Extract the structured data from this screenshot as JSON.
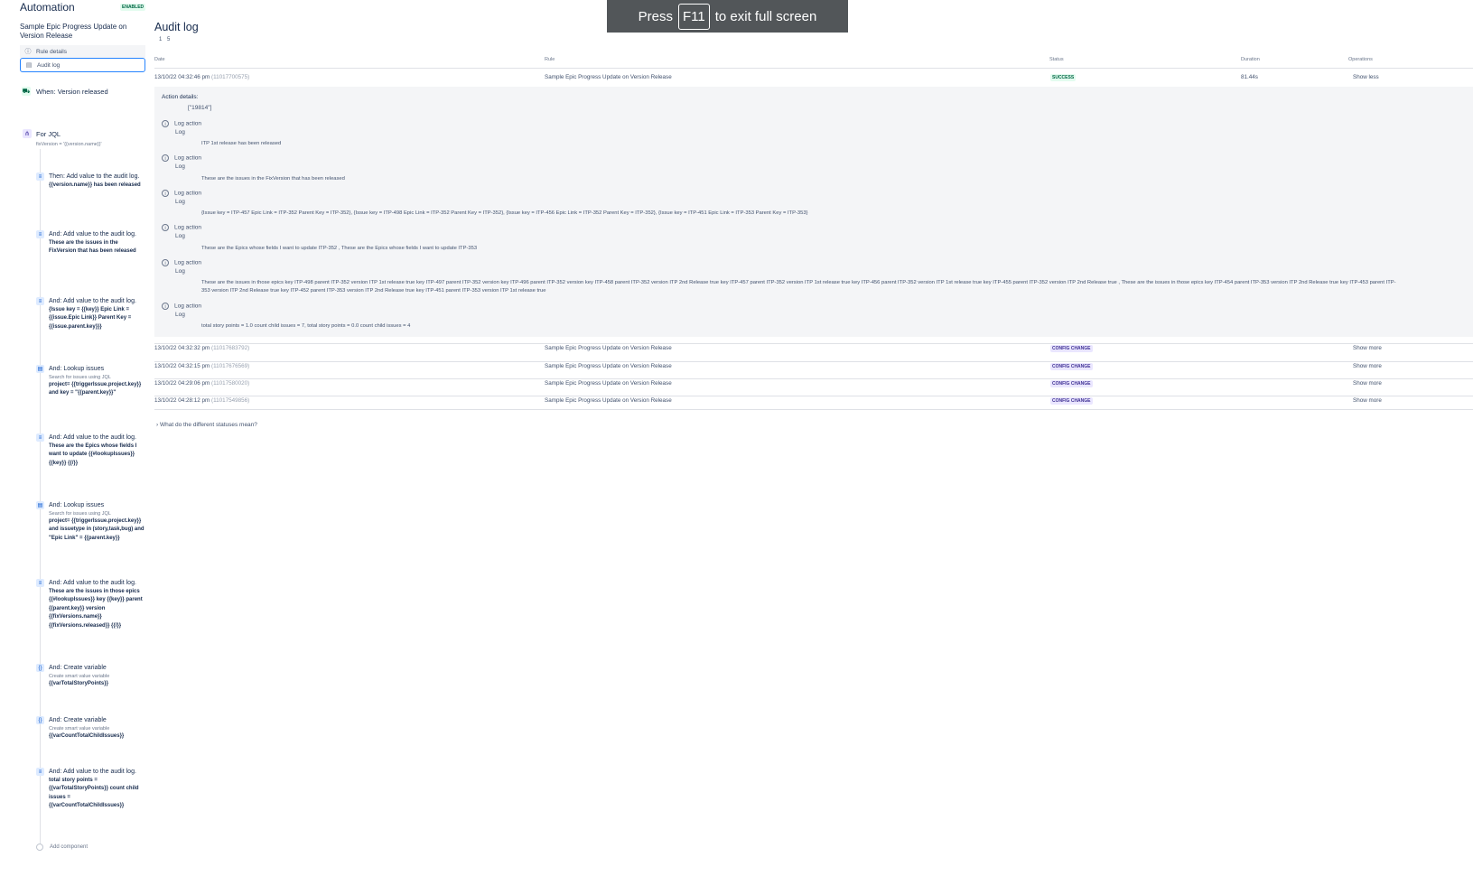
{
  "app": {
    "title": "Automation",
    "status_badge": "ENABLED"
  },
  "rule": {
    "name": "Sample Epic Progress Update on Version Release"
  },
  "nav": {
    "rule_details": "Rule details",
    "audit_log": "Audit log"
  },
  "trigger": {
    "label": "When: Version released"
  },
  "branch": {
    "label": "For JQL",
    "query": "fixVersion = '{{version.name}}'"
  },
  "components": [
    {
      "icon": "document-icon",
      "glyph": "≡",
      "title": "Then: Add value to the audit log.",
      "desc": "",
      "body": "{{version.name}} has been released"
    },
    {
      "icon": "document-icon",
      "glyph": "≡",
      "title": "And: Add value to the audit log.",
      "desc": "",
      "body": "These are the issues in the FixVersion that has been released"
    },
    {
      "icon": "document-icon",
      "glyph": "≡",
      "title": "And: Add value to the audit log.",
      "desc": "",
      "body": "{Issue key = {{key}} Epic Link = {{issue.Epic Link}} Parent Key = {{issue.parent.key}}}"
    },
    {
      "icon": "lookup-icon",
      "glyph": "▤",
      "title": "And: Lookup issues",
      "desc": "Search for issues using JQL",
      "body": "project= {{triggerIssue.project.key}} and key = \"{{parent.key}}\""
    },
    {
      "icon": "document-icon",
      "glyph": "≡",
      "title": "And: Add value to the audit log.",
      "desc": "",
      "body": "These are the Epics whose fields I want to update {{#lookupIssues}} {{key}} {{/}}"
    },
    {
      "icon": "lookup-icon",
      "glyph": "▤",
      "title": "And: Lookup issues",
      "desc": "Search for issues using JQL",
      "body": "project= {{triggerIssue.project.key}} and issuetype in (story,task,bug) and \"Epic Link\" = {{parent.key}}"
    },
    {
      "icon": "document-icon",
      "glyph": "≡",
      "title": "And: Add value to the audit log.",
      "desc": "",
      "body": "These are the issues in those epics {{#lookupIssues}} key {{key}} parent {{parent.key}} version {{fixVersions.name}} {{fixVersions.released}} {{/}}"
    },
    {
      "icon": "variable-icon",
      "glyph": "{}",
      "title": "And: Create variable",
      "desc": "Create smart value variable",
      "body": "{{varTotalStoryPoints}}"
    },
    {
      "icon": "variable-icon",
      "glyph": "{}",
      "title": "And: Create variable",
      "desc": "Create smart value variable",
      "body": "{{varCountTotalChildIssues}}"
    },
    {
      "icon": "document-icon",
      "glyph": "≡",
      "title": "And: Add value to the audit log.",
      "desc": "",
      "body": "total story points = {{varTotalStoryPoints}} count child issues = {{varCountTotalChildIssues}}"
    }
  ],
  "add_component": "Add component",
  "audit": {
    "title": "Audit log",
    "pages": "1 5",
    "columns": {
      "date": "Date",
      "rule": "Rule",
      "status": "Status",
      "duration": "Duration",
      "operations": "Operations"
    },
    "rows": [
      {
        "date": "13/10/22 04:32:46 pm",
        "id": "(11017700575)",
        "rule": "Sample Epic Progress Update on Version Release",
        "status": "SUCCESS",
        "duration": "81.44s",
        "op": "Show less"
      },
      {
        "date": "13/10/22 04:32:32 pm",
        "id": "(11017683792)",
        "rule": "Sample Epic Progress Update on Version Release",
        "status": "CONFIG CHANGE",
        "duration": "",
        "op": "Show more"
      },
      {
        "date": "13/10/22 04:32:15 pm",
        "id": "(11017676569)",
        "rule": "Sample Epic Progress Update on Version Release",
        "status": "CONFIG CHANGE",
        "duration": "",
        "op": "Show more"
      },
      {
        "date": "13/10/22 04:29:06 pm",
        "id": "(11017580020)",
        "rule": "Sample Epic Progress Update on Version Release",
        "status": "CONFIG CHANGE",
        "duration": "",
        "op": "Show more"
      },
      {
        "date": "13/10/22 04:28:12 pm",
        "id": "(11017549856)",
        "rule": "Sample Epic Progress Update on Version Release",
        "status": "CONFIG CHANGE",
        "duration": "",
        "op": "Show more"
      }
    ],
    "action_details": {
      "label": "Action details:",
      "value": "[\"19814\"]",
      "entries": [
        {
          "action": "Log action",
          "type": "Log",
          "message": "ITP 1st release has been released"
        },
        {
          "action": "Log action",
          "type": "Log",
          "message": "These are the issues in the FixVersion that has been released"
        },
        {
          "action": "Log action",
          "type": "Log",
          "message": "{Issue key = ITP-457 Epic Link = ITP-352 Parent Key = ITP-352}, {Issue key = ITP-498 Epic Link = ITP-352 Parent Key = ITP-352}, {Issue key = ITP-456 Epic Link = ITP-352 Parent Key = ITP-352}, {Issue key = ITP-451 Epic Link = ITP-353 Parent Key = ITP-353}"
        },
        {
          "action": "Log action",
          "type": "Log",
          "message": "These are the Epics whose fields I want to update ITP-352 , These are the Epics whose fields I want to update ITP-353"
        },
        {
          "action": "Log action",
          "type": "Log",
          "message": "These are the issues in those epics key ITP-498 parent ITP-352 version ITP 1st release true key ITP-497 parent ITP-352 version key ITP-496 parent ITP-352 version key ITP-458 parent ITP-352 version ITP 2nd Release true key ITP-457 parent ITP-352 version ITP 1st release true key ITP-456 parent ITP-352 version ITP 1st release true key ITP-455 parent ITP-352 version ITP 2nd Release true , These are the issues in those epics key ITP-454 parent ITP-353 version ITP 2nd Release true key ITP-453 parent ITP-353 version ITP 2nd Release true key ITP-452 parent ITP-353 version ITP 2nd Release true key ITP-451 parent ITP-353 version ITP 1st release true"
        },
        {
          "action": "Log action",
          "type": "Log",
          "message": "total story points = 1.0 count child issues = 7, total story points = 0.0 count child issues = 4"
        }
      ]
    },
    "statuses_help": "What do the different statuses mean?"
  },
  "fullscreen_toast": {
    "pre": "Press",
    "key": "F11",
    "post": "to exit full screen"
  },
  "colors": {
    "success": "#006644",
    "config_change": "#403294",
    "focus": "#2684ff",
    "toast_bg": "#525659"
  }
}
